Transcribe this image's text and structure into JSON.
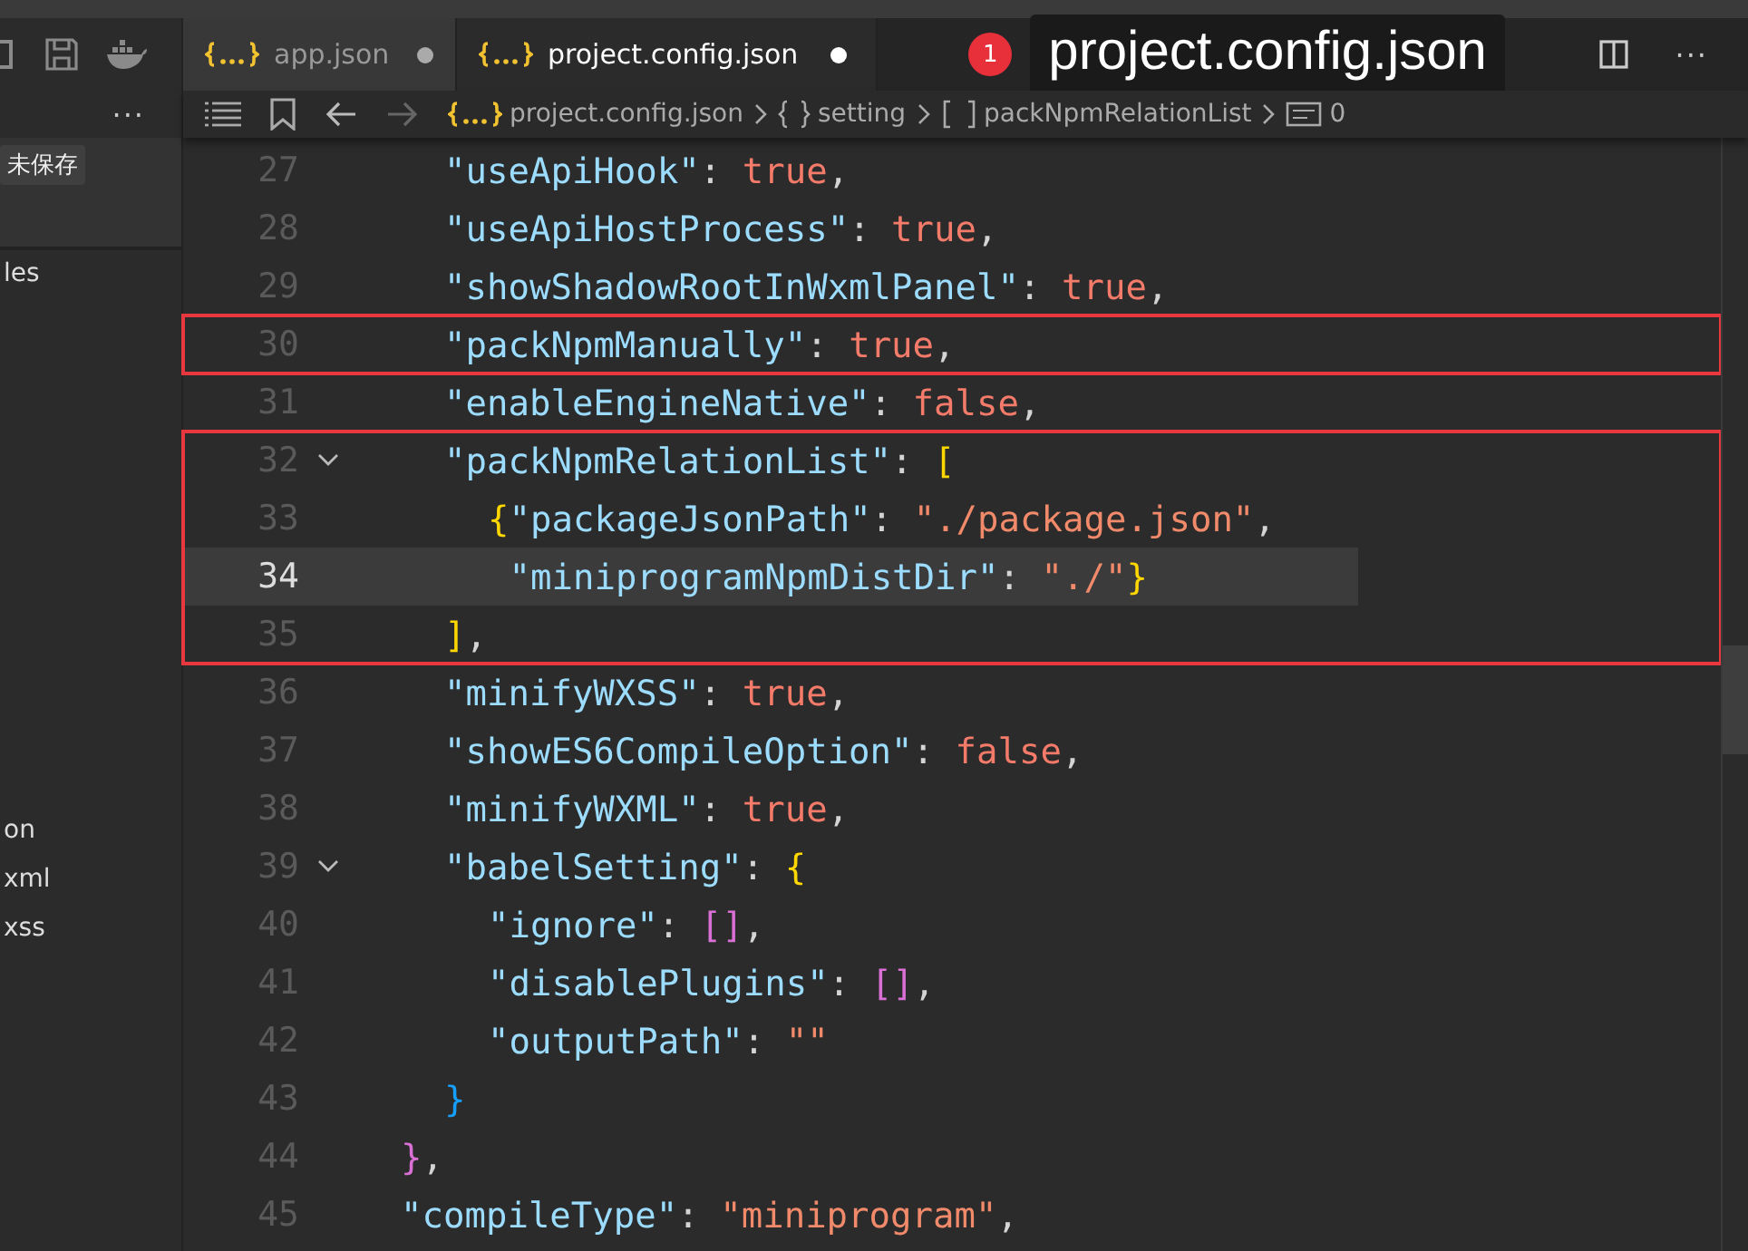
{
  "sidebar": {
    "more": "···",
    "unsaved_badge": "未保存",
    "file_groups": [
      [
        "les"
      ],
      [
        "on",
        "xml",
        "xss"
      ]
    ]
  },
  "tabs": [
    {
      "label": "app.json",
      "selected": false,
      "dirty": true
    },
    {
      "label": "project.config.json",
      "selected": true,
      "dirty": true
    }
  ],
  "tooltip": {
    "badge": "1",
    "text": "project.config.json"
  },
  "editor_actions": {
    "more": "···"
  },
  "breadcrumbs": [
    {
      "kind": "file",
      "label": "project.config.json"
    },
    {
      "kind": "object",
      "label": "setting"
    },
    {
      "kind": "array",
      "label": "packNpmRelationList"
    },
    {
      "kind": "string",
      "label": "0"
    }
  ],
  "code_lines": [
    {
      "kind": "block",
      "children": [
        {
          "kind": "line",
          "number": "27",
          "current": false,
          "foldable": false,
          "boxed": false,
          "tokens": [
            {
              "kind": "key",
              "text": "\"useApiHook\""
            },
            {
              "kind": "punct",
              "text": ": "
            },
            {
              "kind": "bool",
              "text": "true"
            },
            {
              "kind": "punct",
              "text": ","
            }
          ]
        },
        {
          "kind": "line",
          "number": "28",
          "current": false,
          "foldable": false,
          "boxed": false,
          "tokens": [
            {
              "kind": "key",
              "text": "\"useApiHostProcess\""
            },
            {
              "kind": "punct",
              "text": ": "
            },
            {
              "kind": "bool",
              "text": "true"
            },
            {
              "kind": "punct",
              "text": ","
            }
          ]
        },
        {
          "kind": "line",
          "number": "29",
          "current": false,
          "foldable": false,
          "boxed": false,
          "tokens": [
            {
              "kind": "key",
              "text": "\"showShadowRootInWxmlPanel\""
            },
            {
              "kind": "punct",
              "text": ": "
            },
            {
              "kind": "bool",
              "text": "true"
            },
            {
              "kind": "punct",
              "text": ","
            }
          ]
        },
        {
          "kind": "line",
          "number": "30",
          "current": false,
          "foldable": false,
          "boxed": true,
          "tokens": [
            {
              "kind": "key",
              "text": "\"packNpmManually\""
            },
            {
              "kind": "punct",
              "text": ": "
            },
            {
              "kind": "bool",
              "text": "true"
            },
            {
              "kind": "punct",
              "text": ","
            }
          ]
        },
        {
          "kind": "line",
          "number": "31",
          "current": false,
          "foldable": false,
          "boxed": false,
          "tokens": [
            {
              "kind": "key",
              "text": "\"enableEngineNative\""
            },
            {
              "kind": "punct",
              "text": ": "
            },
            {
              "kind": "bool",
              "text": "false"
            },
            {
              "kind": "punct",
              "text": ","
            }
          ]
        },
        {
          "kind": "line",
          "number": "32",
          "current": false,
          "foldable": true,
          "boxed": true,
          "tokens": [
            {
              "kind": "key",
              "text": "\"packNpmRelationList\""
            },
            {
              "kind": "punct",
              "text": ": "
            },
            {
              "kind": "bracket_gold",
              "text": "["
            }
          ],
          "children": [
            {
              "kind": "line",
              "number": "33",
              "current": false,
              "foldable": false,
              "boxed": true,
              "tokens": [
                {
                  "kind": "bracket_gold",
                  "text": "{"
                },
                {
                  "kind": "key",
                  "text": "\"packageJsonPath\""
                },
                {
                  "kind": "punct",
                  "text": ": "
                },
                {
                  "kind": "string",
                  "text": "\"./package.json\""
                },
                {
                  "kind": "punct",
                  "text": ","
                }
              ]
            },
            {
              "kind": "line",
              "number": "34",
              "current": true,
              "foldable": false,
              "boxed": true,
              "tokens": [
                {
                  "kind": "key",
                  "text": " \"miniprogramNpmDistDir\""
                },
                {
                  "kind": "punct",
                  "text": ": "
                },
                {
                  "kind": "string",
                  "text": "\"./\""
                },
                {
                  "kind": "bracket_gold",
                  "text": "}"
                }
              ]
            }
          ]
        },
        {
          "kind": "line",
          "number": "35",
          "current": false,
          "foldable": false,
          "boxed": true,
          "tokens": [
            {
              "kind": "bracket_gold",
              "text": "]"
            },
            {
              "kind": "punct",
              "text": ","
            }
          ]
        },
        {
          "kind": "line",
          "number": "36",
          "current": false,
          "foldable": false,
          "boxed": false,
          "tokens": [
            {
              "kind": "key",
              "text": "\"minifyWXSS\""
            },
            {
              "kind": "punct",
              "text": ": "
            },
            {
              "kind": "bool",
              "text": "true"
            },
            {
              "kind": "punct",
              "text": ","
            }
          ]
        },
        {
          "kind": "line",
          "number": "37",
          "current": false,
          "foldable": false,
          "boxed": false,
          "tokens": [
            {
              "kind": "key",
              "text": "\"showES6CompileOption\""
            },
            {
              "kind": "punct",
              "text": ": "
            },
            {
              "kind": "bool",
              "text": "false"
            },
            {
              "kind": "punct",
              "text": ","
            }
          ]
        },
        {
          "kind": "line",
          "number": "38",
          "current": false,
          "foldable": false,
          "boxed": false,
          "tokens": [
            {
              "kind": "key",
              "text": "\"minifyWXML\""
            },
            {
              "kind": "punct",
              "text": ": "
            },
            {
              "kind": "bool",
              "text": "true"
            },
            {
              "kind": "punct",
              "text": ","
            }
          ]
        },
        {
          "kind": "line",
          "number": "39",
          "current": false,
          "foldable": true,
          "boxed": false,
          "tokens": [
            {
              "kind": "key",
              "text": "\"babelSetting\""
            },
            {
              "kind": "punct",
              "text": ": "
            },
            {
              "kind": "bracket_gold",
              "text": "{"
            }
          ],
          "children": [
            {
              "kind": "line",
              "number": "40",
              "current": false,
              "foldable": false,
              "boxed": false,
              "tokens": [
                {
                  "kind": "key",
                  "text": "\"ignore\""
                },
                {
                  "kind": "punct",
                  "text": ": "
                },
                {
                  "kind": "bracket_pink",
                  "text": "[]"
                },
                {
                  "kind": "punct",
                  "text": ","
                }
              ]
            },
            {
              "kind": "line",
              "number": "41",
              "current": false,
              "foldable": false,
              "boxed": false,
              "tokens": [
                {
                  "kind": "key",
                  "text": "\"disablePlugins\""
                },
                {
                  "kind": "punct",
                  "text": ": "
                },
                {
                  "kind": "bracket_pink",
                  "text": "[]"
                },
                {
                  "kind": "punct",
                  "text": ","
                }
              ]
            },
            {
              "kind": "line",
              "number": "42",
              "current": false,
              "foldable": false,
              "boxed": false,
              "tokens": [
                {
                  "kind": "key",
                  "text": "\"outputPath\""
                },
                {
                  "kind": "punct",
                  "text": ": "
                },
                {
                  "kind": "string",
                  "text": "\"\""
                }
              ]
            }
          ]
        },
        {
          "kind": "line",
          "number": "43",
          "current": false,
          "foldable": false,
          "boxed": false,
          "tokens": [
            {
              "kind": "bracket_blue",
              "text": "}"
            }
          ]
        }
      ]
    },
    {
      "kind": "line",
      "number": "44",
      "current": false,
      "foldable": false,
      "boxed": false,
      "tokens": [
        {
          "kind": "bracket_pink",
          "text": "}"
        },
        {
          "kind": "punct",
          "text": ","
        }
      ]
    },
    {
      "kind": "line",
      "number": "45",
      "current": false,
      "foldable": false,
      "boxed": false,
      "tokens": [
        {
          "kind": "key",
          "text": "\"compileType\""
        },
        {
          "kind": "punct",
          "text": ": "
        },
        {
          "kind": "string",
          "text": "\"miniprogram\""
        },
        {
          "kind": "punct",
          "text": ","
        }
      ]
    }
  ]
}
